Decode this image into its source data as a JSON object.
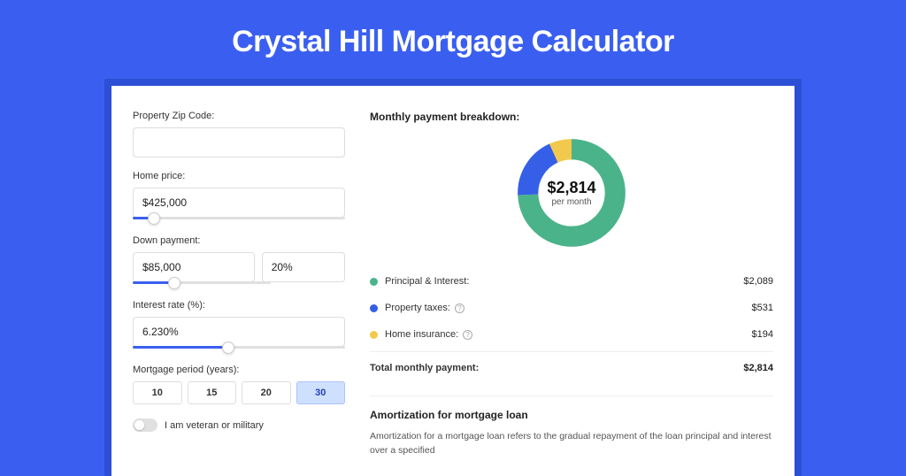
{
  "page_title": "Crystal Hill Mortgage Calculator",
  "form": {
    "zip": {
      "label": "Property Zip Code:",
      "value": ""
    },
    "home_price": {
      "label": "Home price:",
      "value": "$425,000",
      "slider_fill": 10
    },
    "down_payment": {
      "label": "Down payment:",
      "value_amount": "$85,000",
      "value_percent": "20%",
      "slider_fill": 30
    },
    "interest_rate": {
      "label": "Interest rate (%):",
      "value": "6.230%",
      "slider_fill": 45
    },
    "period": {
      "label": "Mortgage period (years):",
      "options": [
        "10",
        "15",
        "20",
        "30"
      ],
      "active_index": 3
    },
    "veteran": {
      "label": "I am veteran or military",
      "on": false
    }
  },
  "breakdown": {
    "title": "Monthly payment breakdown:",
    "center_amount": "$2,814",
    "center_sub": "per month",
    "items": [
      {
        "label": "Principal & Interest:",
        "value": "$2,089",
        "color": "#4bb38a",
        "has_info": false
      },
      {
        "label": "Property taxes:",
        "value": "$531",
        "color": "#355fe6",
        "has_info": true
      },
      {
        "label": "Home insurance:",
        "value": "$194",
        "color": "#f2c94c",
        "has_info": true
      }
    ],
    "total_label": "Total monthly payment:",
    "total_value": "$2,814"
  },
  "chart_data": {
    "type": "pie",
    "title": "Monthly payment breakdown",
    "series": [
      {
        "name": "Principal & Interest",
        "value": 2089,
        "color": "#4bb38a"
      },
      {
        "name": "Property taxes",
        "value": 531,
        "color": "#355fe6"
      },
      {
        "name": "Home insurance",
        "value": 194,
        "color": "#f2c94c"
      }
    ],
    "total": 2814,
    "center_label": "$2,814 per month"
  },
  "amort": {
    "title": "Amortization for mortgage loan",
    "text": "Amortization for a mortgage loan refers to the gradual repayment of the loan principal and interest over a specified"
  }
}
